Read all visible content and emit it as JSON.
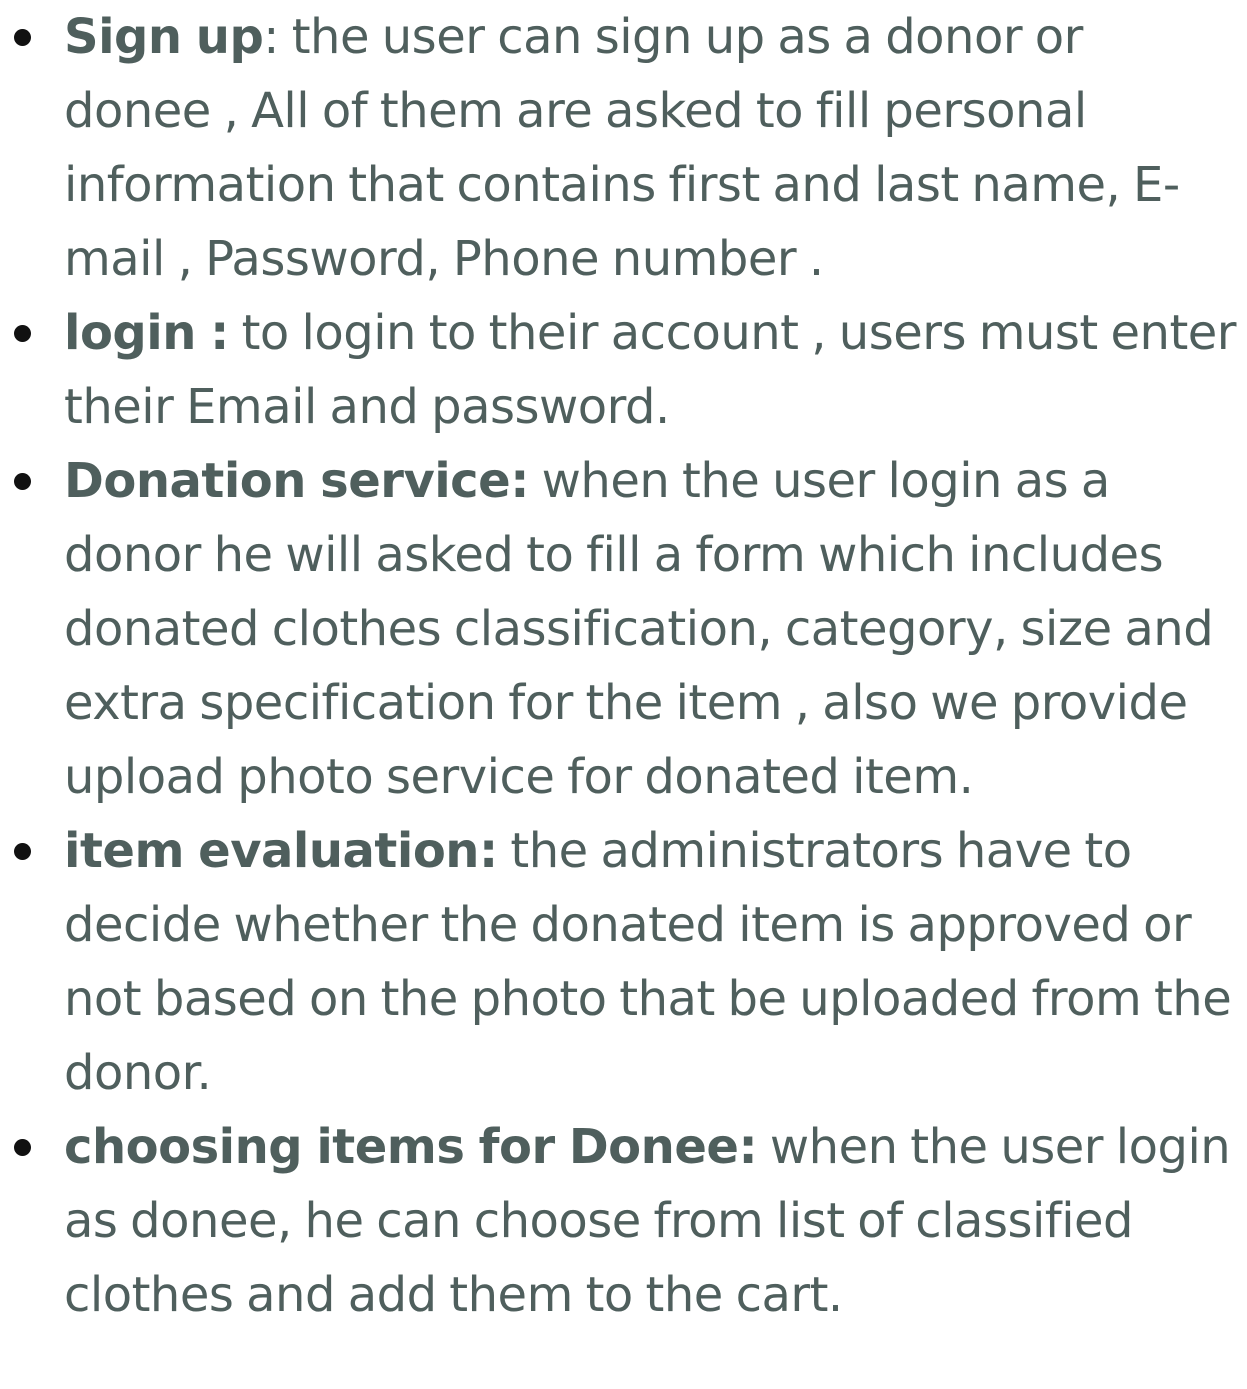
{
  "items": [
    {
      "term": "Sign up",
      "separator": ":",
      "description": " the user can sign up as a donor or donee , All of them are asked to fill personal information that contains first and last name, E-mail , Password, Phone number ."
    },
    {
      "term": "login :",
      "separator": "",
      "description": " to login to their account , users must enter their Email and password."
    },
    {
      "term": "Donation service:",
      "separator": "",
      "description": " when the user login as a donor he will asked to fill a form which includes donated clothes classification, category, size and extra specification for the item , also we provide upload photo service for donated item."
    },
    {
      "term": "item evaluation:",
      "separator": "",
      "description": " the administrators have to decide whether the donated item is approved or not based on the photo that be uploaded from the donor."
    },
    {
      "term": "choosing items for Donee:",
      "separator": "",
      "description": " when the user login as donee, he can choose from list of classified clothes and add them to the cart."
    }
  ],
  "colors": {
    "text": "#4f5f5d",
    "bullet": "#111111",
    "background": "#ffffff"
  }
}
